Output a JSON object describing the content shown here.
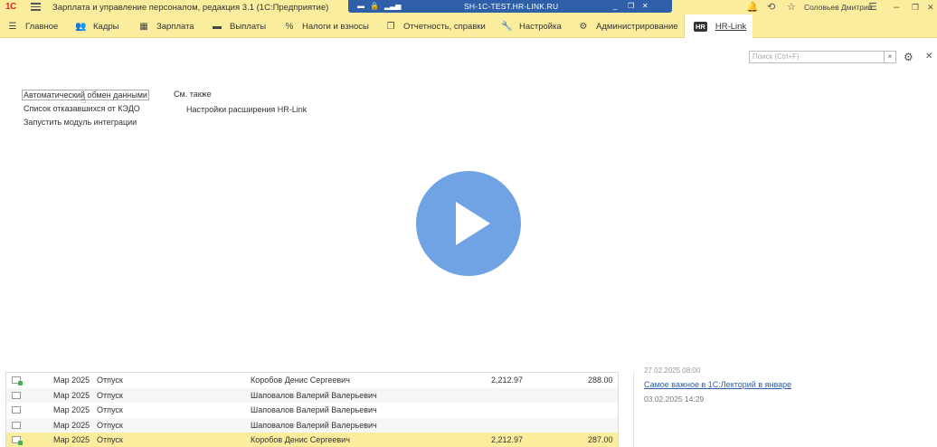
{
  "titlebar": {
    "logo": "1С",
    "app_title": "Зарплата и управление персоналом, редакция 3.1  (1С:Предприятие)",
    "rdp_host": "SH-1C-TEST.HR-LINK.RU",
    "user_name": "Соловьев Дмитрий"
  },
  "menu": {
    "items": [
      {
        "label": "Главное",
        "icon": "burger-icon"
      },
      {
        "label": "Кадры",
        "icon": "people-icon"
      },
      {
        "label": "Зарплата",
        "icon": "calculator-icon"
      },
      {
        "label": "Выплаты",
        "icon": "wallet-icon"
      },
      {
        "label": "Налоги и взносы",
        "icon": "percent-icon"
      },
      {
        "label": "Отчетность, справки",
        "icon": "reports-icon"
      },
      {
        "label": "Настройка",
        "icon": "wrench-icon"
      },
      {
        "label": "Администрирование",
        "icon": "gear-icon"
      }
    ],
    "active": {
      "label": "HR-Link",
      "badge": "HR"
    }
  },
  "search": {
    "placeholder": "Поиск (Ctrl+F)",
    "clear": "×"
  },
  "links": {
    "left": [
      "Автоматический обмен данными",
      "Список отказавшихся от КЭДО",
      "Запустить модуль интеграции"
    ],
    "see_also_title": "См. также",
    "see_also": [
      "Настройки расширения HR-Link"
    ]
  },
  "table": {
    "rows": [
      {
        "period": "Мар 2025",
        "type": "Отпуск",
        "employee": "Коробов Денис Сергеевич",
        "amount": "2,212.97",
        "tax": "288.00",
        "posted": true
      },
      {
        "period": "Мар 2025",
        "type": "Отпуск",
        "employee": "Шаповалов Валерий Валерьевич",
        "amount": "",
        "tax": "",
        "posted": false
      },
      {
        "period": "Мар 2025",
        "type": "Отпуск",
        "employee": "Шаповалов Валерий Валерьевич",
        "amount": "",
        "tax": "",
        "posted": false
      },
      {
        "period": "Мар 2025",
        "type": "Отпуск",
        "employee": "Шаповалов Валерий Валерьевич",
        "amount": "",
        "tax": "",
        "posted": false
      },
      {
        "period": "Мар 2025",
        "type": "Отпуск",
        "employee": "Коробов Денис Сергеевич",
        "amount": "2,212.97",
        "tax": "287.00",
        "posted": true
      }
    ]
  },
  "news": {
    "date_top": "27.02.2025 08:00",
    "link": "Самое важное в 1С:Лекторий в январе",
    "date": "03.02.2025 14:29"
  },
  "colors": {
    "accent": "#fbed9e",
    "play": "#6fa3e3",
    "link": "#2e5ea8"
  }
}
